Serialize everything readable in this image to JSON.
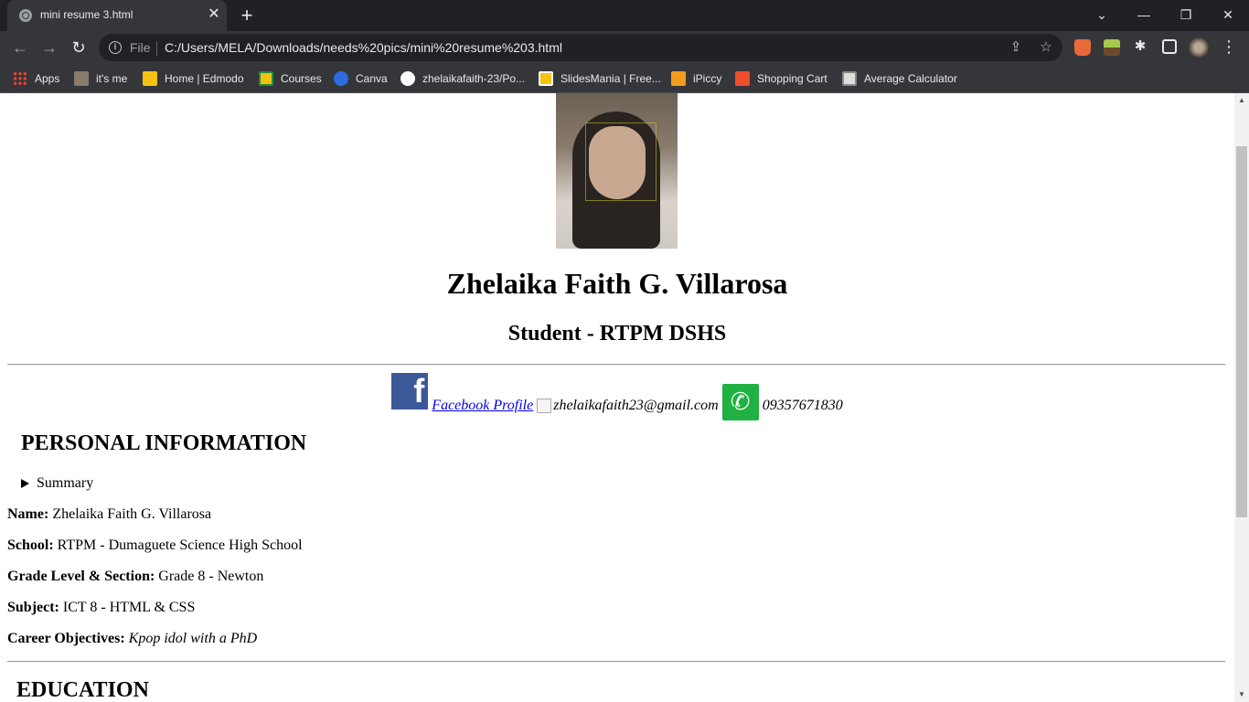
{
  "browser": {
    "tab": {
      "title": "mini resume 3.html",
      "close": "✕"
    },
    "new_tab": "+",
    "window_controls": {
      "dropdown": "⌄",
      "minimize": "—",
      "restore": "❐",
      "close": "✕"
    },
    "nav": {
      "back": "←",
      "forward": "→",
      "reload": "↻"
    },
    "omnibox": {
      "scheme_label": "File",
      "url": "C:/Users/MELA/Downloads/needs%20pics/mini%20resume%203.html",
      "share_icon": "share-icon",
      "star_icon": "star-icon"
    },
    "bookmarks": [
      {
        "label": "Apps",
        "icon": "apps-grid-icon",
        "color": "#e8453c"
      },
      {
        "label": "it's me",
        "icon": "photo-icon",
        "color": "#8a7c6d"
      },
      {
        "label": "Home | Edmodo",
        "icon": "edmodo-icon",
        "color": "#f5c211"
      },
      {
        "label": "Courses",
        "icon": "classroom-icon",
        "color": "#f5c211"
      },
      {
        "label": "Canva",
        "icon": "canva-icon",
        "color": "#2d6cdf"
      },
      {
        "label": "zhelaikafaith-23/Po...",
        "icon": "github-icon",
        "color": "#ffffff"
      },
      {
        "label": "SlidesMania | Free...",
        "icon": "slidesmania-icon",
        "color": "#f5c211"
      },
      {
        "label": "iPiccy",
        "icon": "ipiccy-icon",
        "color": "#f29d1a"
      },
      {
        "label": "Shopping Cart",
        "icon": "shopee-icon",
        "color": "#ee4d2d"
      },
      {
        "label": "Average Calculator",
        "icon": "calculator-icon",
        "color": "#dddddd"
      }
    ]
  },
  "resume": {
    "name": "Zhelaika Faith G. Villarosa",
    "role": "Student - RTPM DSHS",
    "contact": {
      "facebook_label": "Facebook Profile",
      "email": "zhelaikafaith23@gmail.com",
      "phone": "09357671830"
    },
    "personal_heading": "PERSONAL INFORMATION",
    "summary_label": "Summary",
    "info": [
      {
        "label": "Name:",
        "value": "Zhelaika Faith G. Villarosa"
      },
      {
        "label": "School:",
        "value": "RTPM - Dumaguete Science High School"
      },
      {
        "label": "Grade Level & Section:",
        "value": "Grade 8 - Newton"
      },
      {
        "label": "Subject:",
        "value": "ICT 8 - HTML & CSS"
      },
      {
        "label": "Career Objectives:",
        "value": "Kpop idol with a PhD"
      }
    ],
    "education_heading": "EDUCATION"
  }
}
